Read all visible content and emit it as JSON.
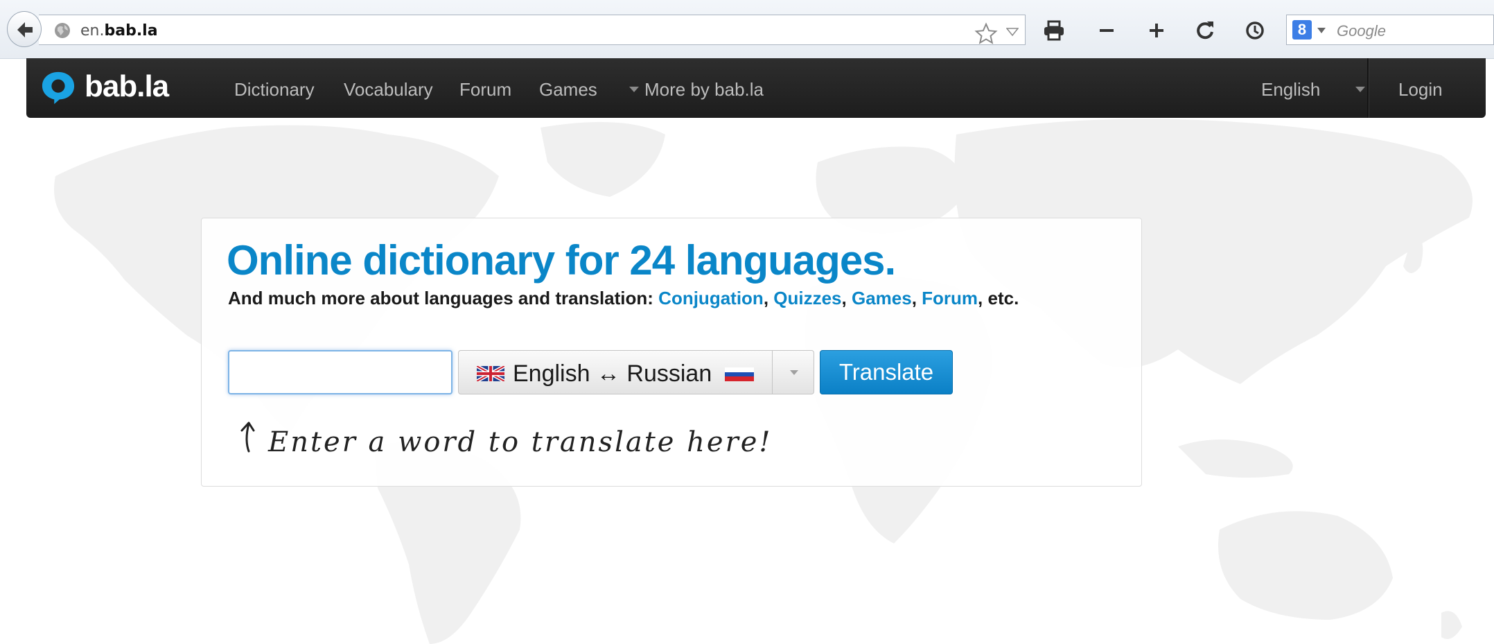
{
  "browser": {
    "url_prefix": "en.",
    "url_domain": "bab.la",
    "search_engine_icon_letter": "8",
    "search_placeholder": "Google",
    "icons": [
      "back-icon",
      "globe-icon",
      "bookmark-star-icon",
      "dropmarker-icon",
      "print-icon",
      "zoom-out-icon",
      "zoom-in-icon",
      "reload-icon",
      "history-icon",
      "google-search-icon"
    ]
  },
  "navbar": {
    "logo_text": "bab.la",
    "items": [
      {
        "label": "Dictionary"
      },
      {
        "label": "Vocabulary"
      },
      {
        "label": "Forum"
      },
      {
        "label": "Games"
      },
      {
        "label": "More by bab.la"
      }
    ],
    "language": "English",
    "login": "Login"
  },
  "main": {
    "headline": "Online dictionary for 24 languages.",
    "subline_prefix": "And much more about languages and translation: ",
    "links": [
      {
        "label": "Conjugation"
      },
      {
        "label": "Quizzes"
      },
      {
        "label": "Games"
      },
      {
        "label": "Forum"
      }
    ],
    "subline_suffix": ", etc.",
    "search_input_value": "",
    "language_pair": "English ↔ Russian",
    "translate_button": "Translate",
    "hint": "Enter a word to translate here!"
  },
  "colors": {
    "accent": "#0a86c8",
    "navbar_bg": "#222222",
    "button_bg": "#1a8fd4",
    "map_gray": "#efefef"
  }
}
